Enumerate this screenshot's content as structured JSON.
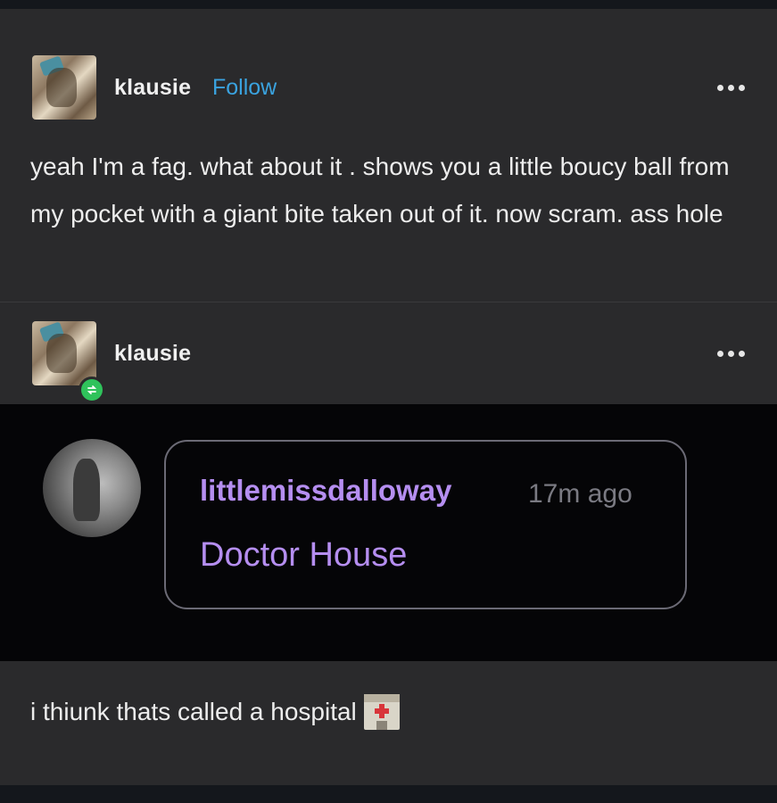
{
  "post": {
    "author": "klausie",
    "follow_label": "Follow",
    "body": "yeah I'm a fag. what about it . shows you a little boucy ball from my pocket with a giant bite taken out of it. now scram. ass hole"
  },
  "reblog": {
    "author": "klausie",
    "chat": {
      "username": "littlemissdalloway",
      "time": "17m ago",
      "message": "Doctor House"
    },
    "body": "i thiunk thats called a hospital",
    "emoji": "hospital-icon"
  },
  "icons": {
    "menu": "more-dots-icon",
    "reblog_badge": "reblog-icon"
  },
  "colors": {
    "follow": "#3aa3e0",
    "chat_text": "#b58ef0",
    "reblog_badge": "#2fc25b"
  }
}
